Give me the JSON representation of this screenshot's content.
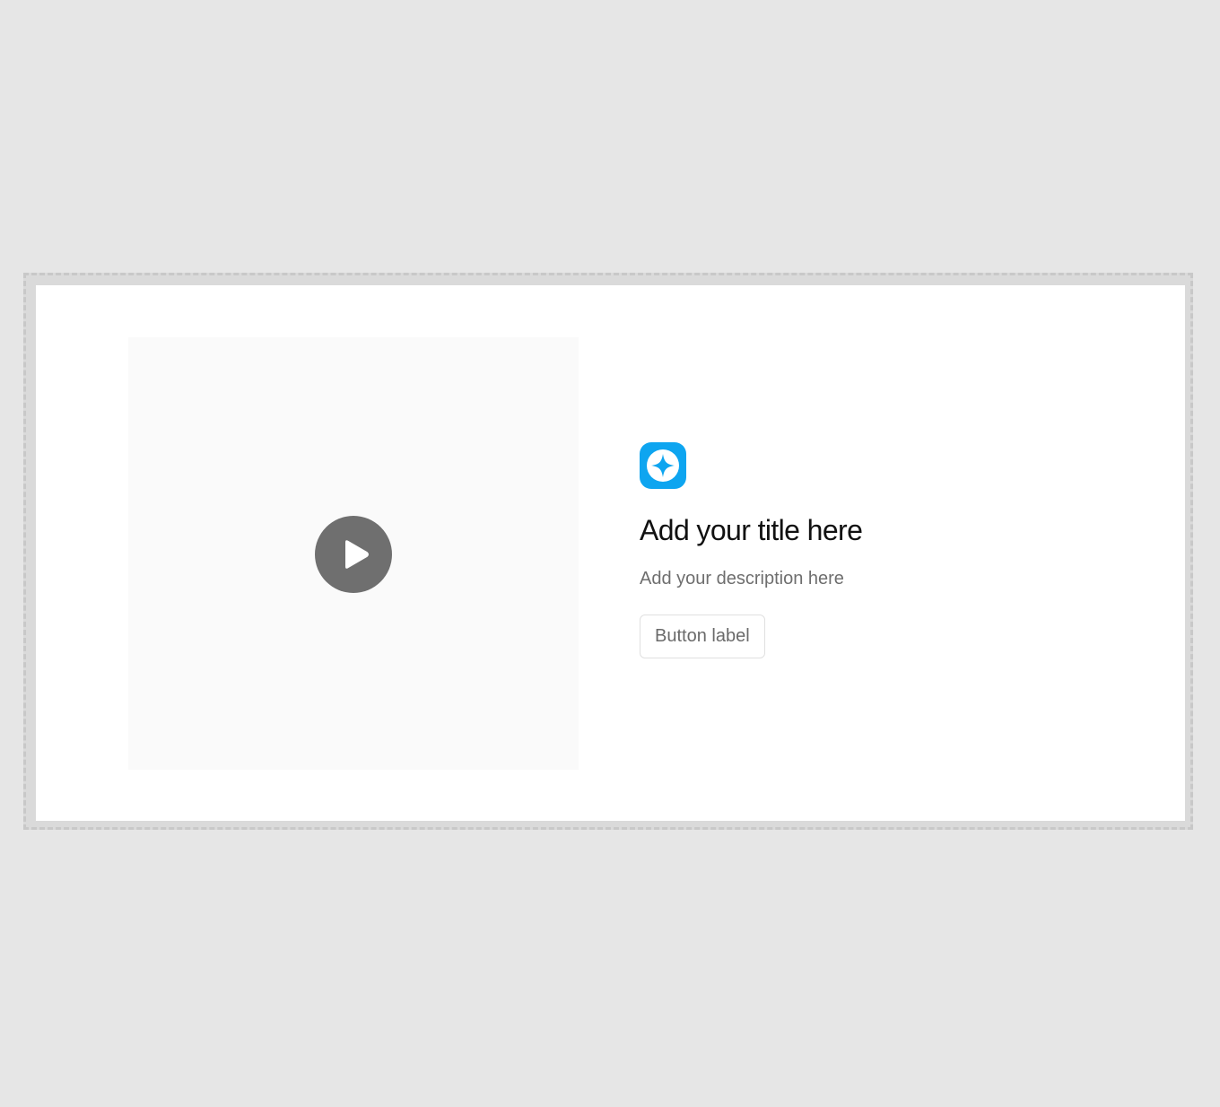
{
  "block": {
    "media": {
      "play_icon": "play-circle-icon",
      "play_color": "#6f6f6f"
    },
    "brand_icon": {
      "name": "sparkle-icon",
      "color": "#0ea5f0"
    },
    "title": "Add your title here",
    "description": "Add your description here",
    "button_label": "Button label"
  }
}
